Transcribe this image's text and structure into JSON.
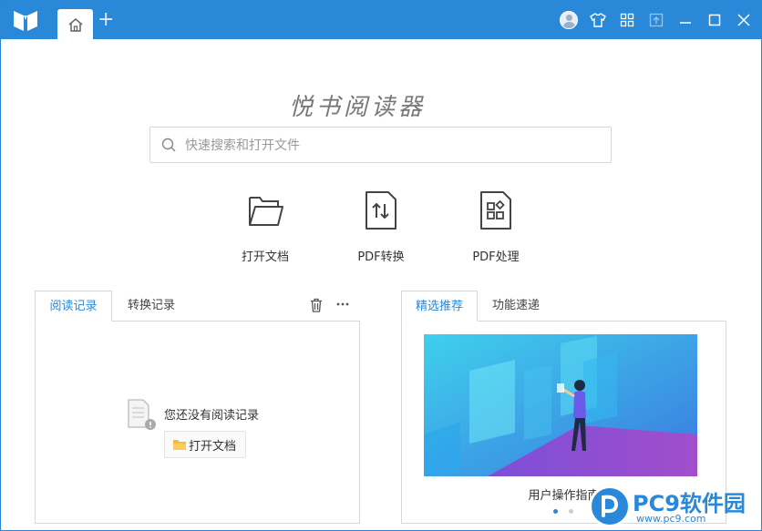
{
  "app": {
    "title": "悦书阅读器"
  },
  "titlebar": {
    "add_tab_symbol": "+"
  },
  "search": {
    "placeholder": "快速搜索和打开文件"
  },
  "quick_actions": [
    {
      "label": "打开文档",
      "icon": "folder-icon"
    },
    {
      "label": "PDF转换",
      "icon": "pdf-convert-icon"
    },
    {
      "label": "PDF处理",
      "icon": "pdf-process-icon"
    }
  ],
  "left_panel": {
    "tabs": [
      "阅读记录",
      "转换记录"
    ],
    "active_tab": 0,
    "empty_text": "您还没有阅读记录",
    "open_button": "打开文档"
  },
  "right_panel": {
    "tabs": [
      "精选推荐",
      "功能速递"
    ],
    "active_tab": 0,
    "banner_caption": "用户操作指南",
    "page_count": 2,
    "current_page": 1
  },
  "watermark": {
    "title": "PC9软件园",
    "url": "www.pc9.com"
  },
  "colors": {
    "accent": "#2a88d8",
    "titlebar": "#2a88d8",
    "border": "#d8d8d8"
  }
}
